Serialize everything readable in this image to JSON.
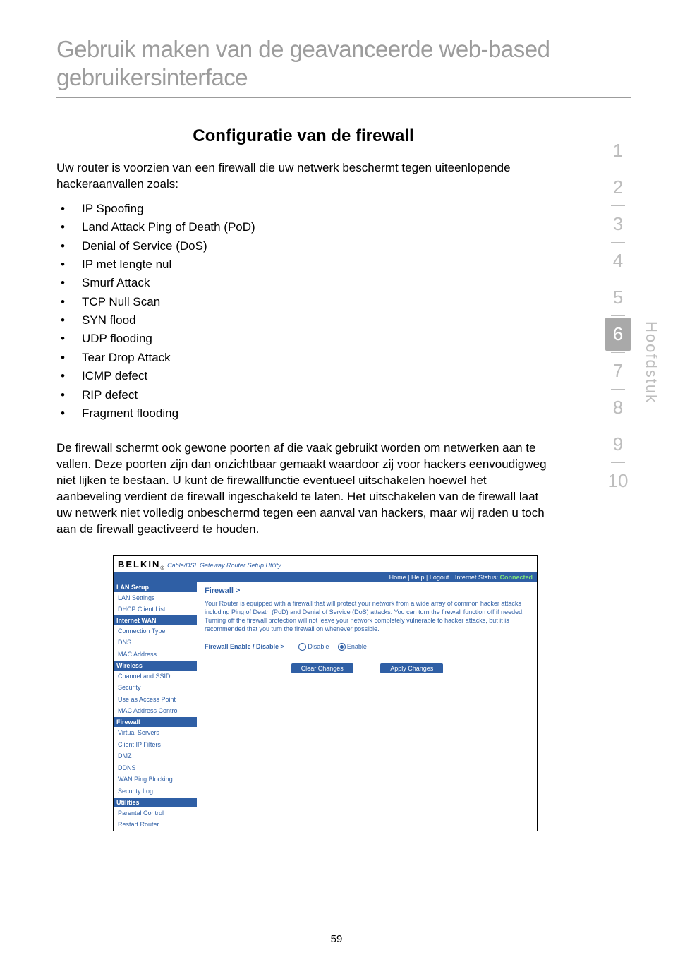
{
  "doc_title": "Gebruik maken van de geavanceerde web-based gebruikersinterface",
  "section_heading": "Configuratie van de firewall",
  "intro": "Uw router is voorzien van een firewall die uw netwerk beschermt tegen uiteenlopende hackeraanvallen zoals:",
  "attacks": [
    "IP Spoofing",
    "Land Attack Ping of Death (PoD)",
    "Denial of Service (DoS)",
    "IP met lengte nul",
    "Smurf Attack",
    "TCP Null Scan",
    "SYN flood",
    "UDP flooding",
    "Tear Drop Attack",
    "ICMP defect",
    "RIP defect",
    "Fragment flooding"
  ],
  "body_para": "De firewall schermt ook gewone poorten af die vaak gebruikt worden om netwerken aan te vallen. Deze poorten zijn dan onzichtbaar gemaakt waardoor zij voor hackers eenvoudigweg niet lijken te bestaan. U kunt de firewallfunctie eventueel uitschakelen hoewel het aanbeveling verdient de firewall ingeschakeld te laten. Het uitschakelen van de firewall laat uw netwerk niet volledig onbeschermd tegen een aanval van hackers, maar wij raden u toch aan de firewall geactiveerd te houden.",
  "side_nav": {
    "items": [
      "1",
      "2",
      "3",
      "4",
      "5",
      "6",
      "7",
      "8",
      "9",
      "10"
    ],
    "active_index": 5,
    "label": "Hoofdstuk"
  },
  "router": {
    "brand": "BELKIN",
    "brand_sub": "Cable/DSL Gateway Router Setup Utility",
    "topbar_links": "Home | Help | Logout",
    "status_label": "Internet Status:",
    "status_value": "Connected",
    "sidebar": [
      {
        "type": "grp",
        "label": "LAN Setup"
      },
      {
        "type": "it",
        "label": "LAN Settings"
      },
      {
        "type": "it",
        "label": "DHCP Client List"
      },
      {
        "type": "grp",
        "label": "Internet WAN"
      },
      {
        "type": "it",
        "label": "Connection Type"
      },
      {
        "type": "it",
        "label": "DNS"
      },
      {
        "type": "it",
        "label": "MAC Address"
      },
      {
        "type": "grp",
        "label": "Wireless"
      },
      {
        "type": "it",
        "label": "Channel and SSID"
      },
      {
        "type": "it",
        "label": "Security"
      },
      {
        "type": "it",
        "label": "Use as Access Point"
      },
      {
        "type": "it",
        "label": "MAC Address Control"
      },
      {
        "type": "grp",
        "label": "Firewall"
      },
      {
        "type": "it",
        "label": "Virtual Servers"
      },
      {
        "type": "it",
        "label": "Client IP Filters"
      },
      {
        "type": "it",
        "label": "DMZ"
      },
      {
        "type": "it",
        "label": "DDNS"
      },
      {
        "type": "it",
        "label": "WAN Ping Blocking"
      },
      {
        "type": "it",
        "label": "Security Log"
      },
      {
        "type": "grp",
        "label": "Utilities"
      },
      {
        "type": "it",
        "label": "Parental Control"
      },
      {
        "type": "it",
        "label": "Restart Router"
      }
    ],
    "crumb": "Firewall >",
    "desc": "Your Router is equipped with a firewall that will protect your network from a wide array of common hacker attacks including Ping of Death (PoD) and Denial of Service (DoS) attacks. You can turn the firewall function off if needed. Turning off the firewall protection will not leave your network completely vulnerable to hacker attacks, but it is recommended that you turn the firewall on whenever possible.",
    "radio_label": "Firewall Enable / Disable >",
    "radio_disable": "Disable",
    "radio_enable": "Enable",
    "radio_selected": "enable",
    "btn_clear": "Clear Changes",
    "btn_apply": "Apply Changes"
  },
  "page_number": "59"
}
